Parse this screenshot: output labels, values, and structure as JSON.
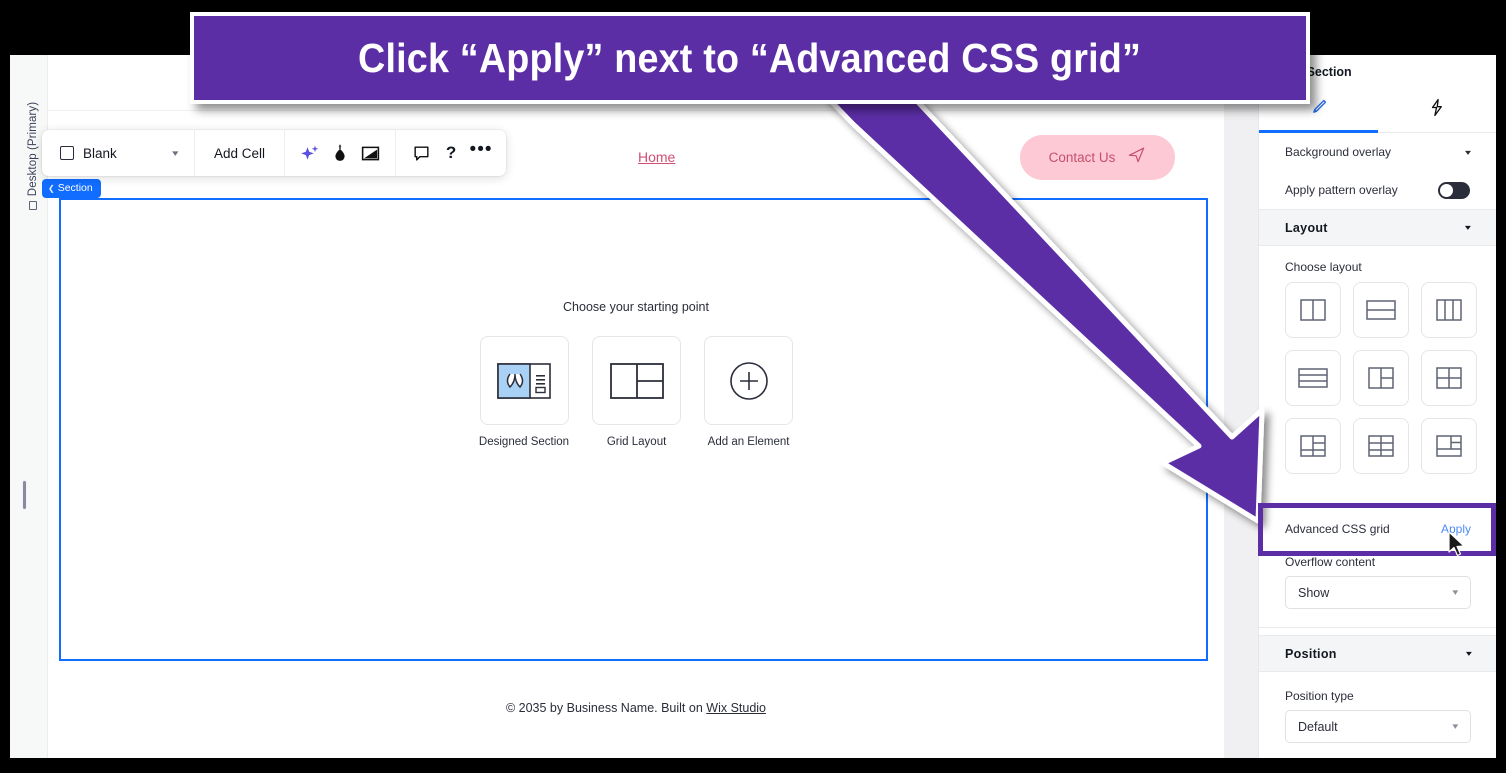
{
  "annotation": {
    "callout_text": "Click “Apply” next to “Advanced CSS grid”",
    "callout_bg": "#5B2EA6",
    "callout_text_color": "#FFFFFF",
    "arrow_color": "#5B2EA6",
    "highlight_target": "Advanced CSS grid row"
  },
  "left_rail": {
    "viewport_label": "Desktop (Primary)",
    "viewport_icon": "desktop-icon"
  },
  "toolbar": {
    "preset_label": "Blank",
    "preset_icon": "square-outline-icon",
    "preset_caret": "chevron-down-icon",
    "add_cell_label": "Add Cell",
    "icons": [
      {
        "name": "ai-sparkle-icon"
      },
      {
        "name": "paint-dropper-icon"
      },
      {
        "name": "resize-media-icon"
      },
      {
        "name": "comment-icon"
      },
      {
        "name": "help-icon",
        "glyph": "?"
      },
      {
        "name": "more-options-icon",
        "glyph": "•••"
      }
    ]
  },
  "canvas": {
    "section_chip_label": "Section",
    "nav": {
      "home_label": "Home",
      "contact_label": "Contact Us",
      "contact_icon": "paper-plane-icon",
      "contact_bg": "#FCC9D4",
      "contact_text_color": "#C5506C",
      "home_link_color": "#D24F74"
    },
    "starting_point": {
      "title": "Choose your starting point",
      "cards": [
        {
          "label": "Designed Section",
          "icon": "designed-section-icon"
        },
        {
          "label": "Grid Layout",
          "icon": "grid-layout-icon"
        },
        {
          "label": "Add an Element",
          "icon": "plus-circle-icon"
        }
      ]
    },
    "footer": {
      "text_before": "© 2035 by Business Name. Built on ",
      "link_text": "Wix Studio"
    },
    "selection_color": "#116DFF"
  },
  "panel": {
    "breadcrumb": "Section",
    "breadcrumb_back_icon": "chevron-left-icon",
    "tabs": [
      {
        "name": "design-tab",
        "icon": "paintbrush-icon",
        "active": true
      },
      {
        "name": "interactions-tab",
        "icon": "lightning-bolt-icon",
        "active": false
      }
    ],
    "rows": {
      "background_overlay": "Background overlay",
      "apply_pattern_overlay": "Apply pattern overlay"
    },
    "layout_section": {
      "heading": "Layout",
      "choose_layout_label": "Choose layout",
      "tiles": [
        "two-columns-icon",
        "two-rows-icon",
        "three-columns-icon",
        "three-rows-icon",
        "left-column-split-right-icon",
        "four-quadrants-icon",
        "left-large-right-split-icon",
        "six-cells-icon",
        "top-split-bottom-row-icon"
      ],
      "advanced_css_grid_label": "Advanced CSS grid",
      "advanced_css_grid_apply": "Apply",
      "overflow_label": "Overflow content",
      "overflow_value": "Show"
    },
    "position_section": {
      "heading": "Position",
      "position_type_label": "Position type",
      "position_type_value": "Default"
    }
  }
}
